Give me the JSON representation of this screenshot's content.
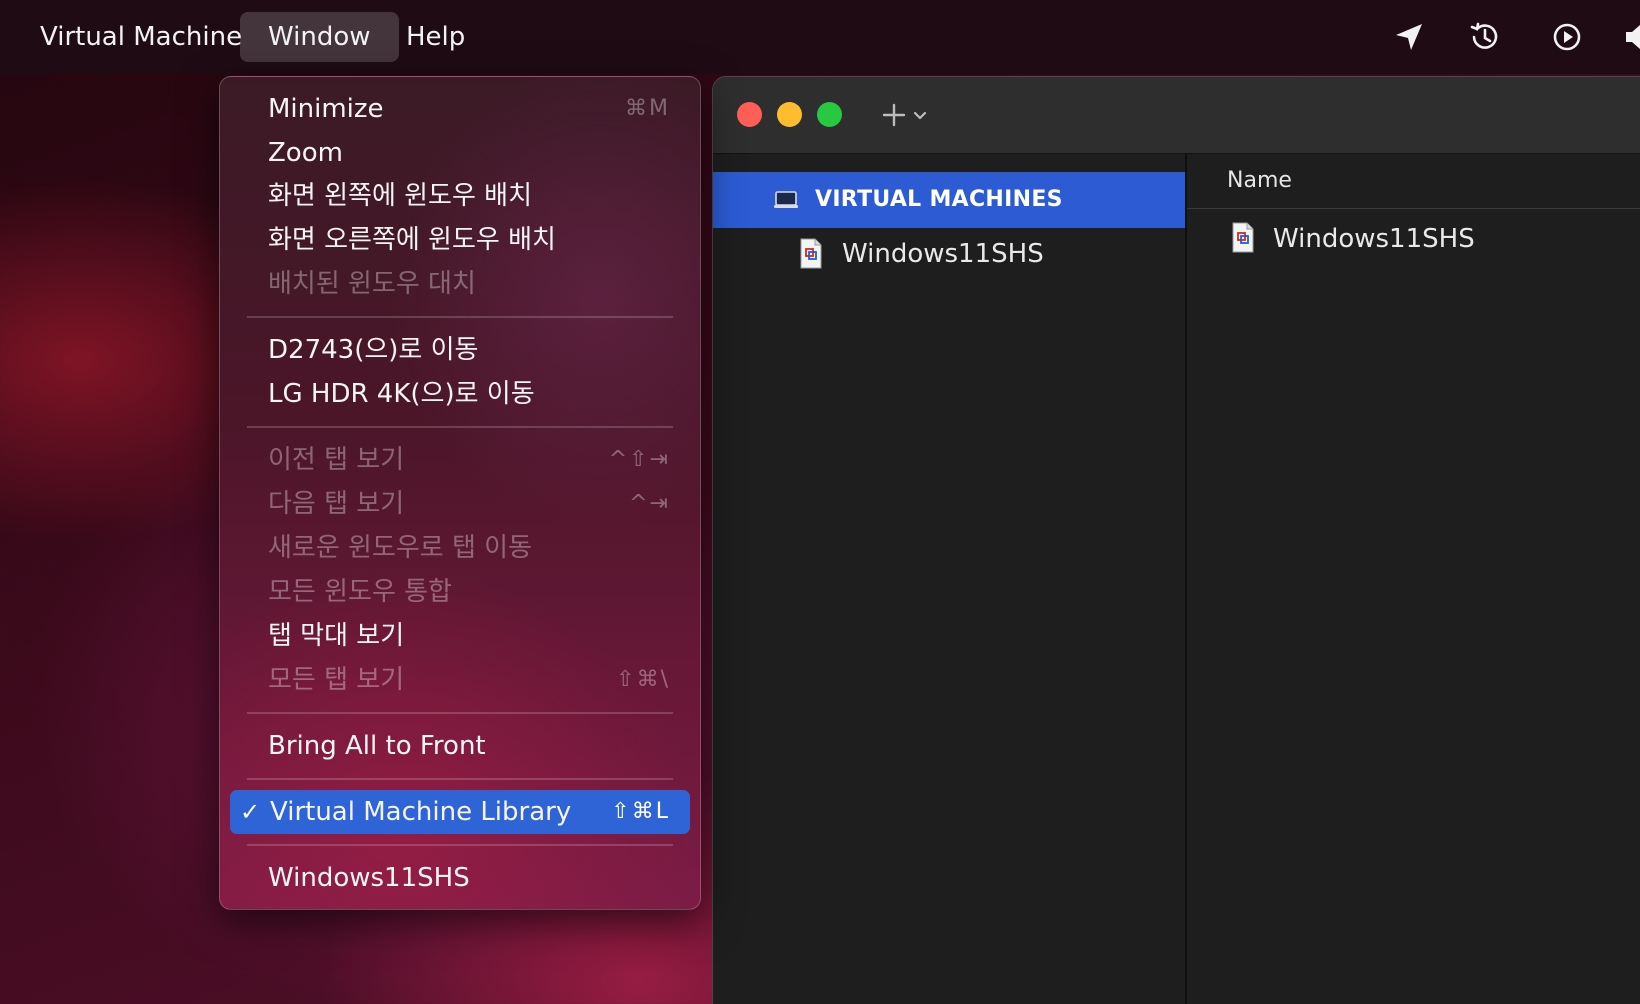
{
  "menubar": {
    "app_label": "Virtual Machine",
    "window_label": "Window",
    "help_label": "Help",
    "status_icons": [
      "location-arrow-icon",
      "time-machine-icon",
      "play-circle-icon",
      "speaker-icon"
    ]
  },
  "window_menu": {
    "minimize": {
      "label": "Minimize",
      "shortcut": "⌘M"
    },
    "zoom": {
      "label": "Zoom"
    },
    "tile_left": {
      "label": "화면 왼쪽에 윈도우 배치"
    },
    "tile_right": {
      "label": "화면 오른쪽에 윈도우 배치"
    },
    "replace_tiled": {
      "label": "배치된 윈도우 대치"
    },
    "move_d2743": {
      "label": "D2743(으)로 이동"
    },
    "move_lg": {
      "label": "LG HDR 4K(으)로 이동"
    },
    "prev_tab": {
      "label": "이전 탭 보기",
      "shortcut": "^⇧⇥"
    },
    "next_tab": {
      "label": "다음 탭 보기",
      "shortcut": "^⇥"
    },
    "move_tab_new_window": {
      "label": "새로운 윈도우로 탭 이동"
    },
    "merge_windows": {
      "label": "모든 윈도우 통합"
    },
    "show_tab_bar": {
      "label": "탭 막대 보기"
    },
    "show_all_tabs": {
      "label": "모든 탭 보기",
      "shortcut": "⇧⌘\\"
    },
    "bring_all_front": {
      "label": "Bring All to Front"
    },
    "vm_library": {
      "label": "Virtual Machine Library",
      "shortcut": "⇧⌘L",
      "checked": true
    },
    "windows11shs": {
      "label": "Windows11SHS"
    }
  },
  "library": {
    "sidebar": {
      "section_label": "VIRTUAL MACHINES",
      "items": [
        {
          "label": "Windows11SHS"
        }
      ]
    },
    "list": {
      "column_name": "Name",
      "rows": [
        {
          "name": "Windows11SHS"
        }
      ]
    }
  },
  "colors": {
    "accent": "#2f64d6",
    "sidebar_selection": "#2c5bd4",
    "traffic_close": "#ff5f57",
    "traffic_minimize": "#febc2e",
    "traffic_maximize": "#28c840"
  }
}
